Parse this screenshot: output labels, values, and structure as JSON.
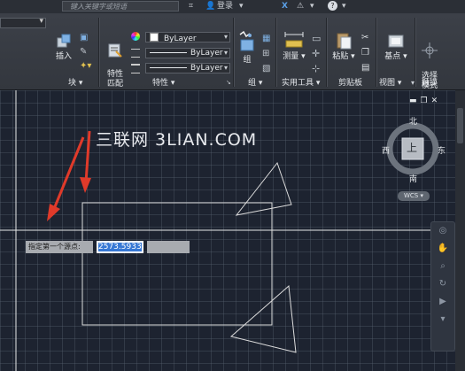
{
  "titlebar": {
    "search_placeholder": "键入关键字或短语",
    "login_label": "登录",
    "help_label": "?"
  },
  "ribbon": {
    "panels": {
      "block": "块 ▾",
      "properties": "特性 ▾",
      "group": "组 ▾",
      "utilities": "实用工具 ▾",
      "clipboard": "剪贴板",
      "view": "视图 ▾",
      "touch": "触摸"
    },
    "insert_label": "插入",
    "match_props_label": "特性\n匹配",
    "group_label": "组",
    "measure_label": "测量",
    "paste_label": "粘贴",
    "base_label": "基点",
    "select_mode_label": "选择\n模式",
    "color_value": "ByLayer",
    "linetype_value": "ByLayer",
    "lineweight_value": "ByLayer"
  },
  "viewcube": {
    "north": "北",
    "south": "南",
    "east": "东",
    "west": "西",
    "top": "上",
    "wcs": "WCS"
  },
  "watermark": "三联网 3LIAN.COM",
  "command": {
    "prompt": "指定第一个源点:",
    "value": "2573.5933"
  },
  "colors": {
    "canvas_bg": "#1d2330",
    "ribbon_bg": "#3a3e45",
    "arrow_red": "#e03a2a",
    "highlight": "#3778d4"
  }
}
